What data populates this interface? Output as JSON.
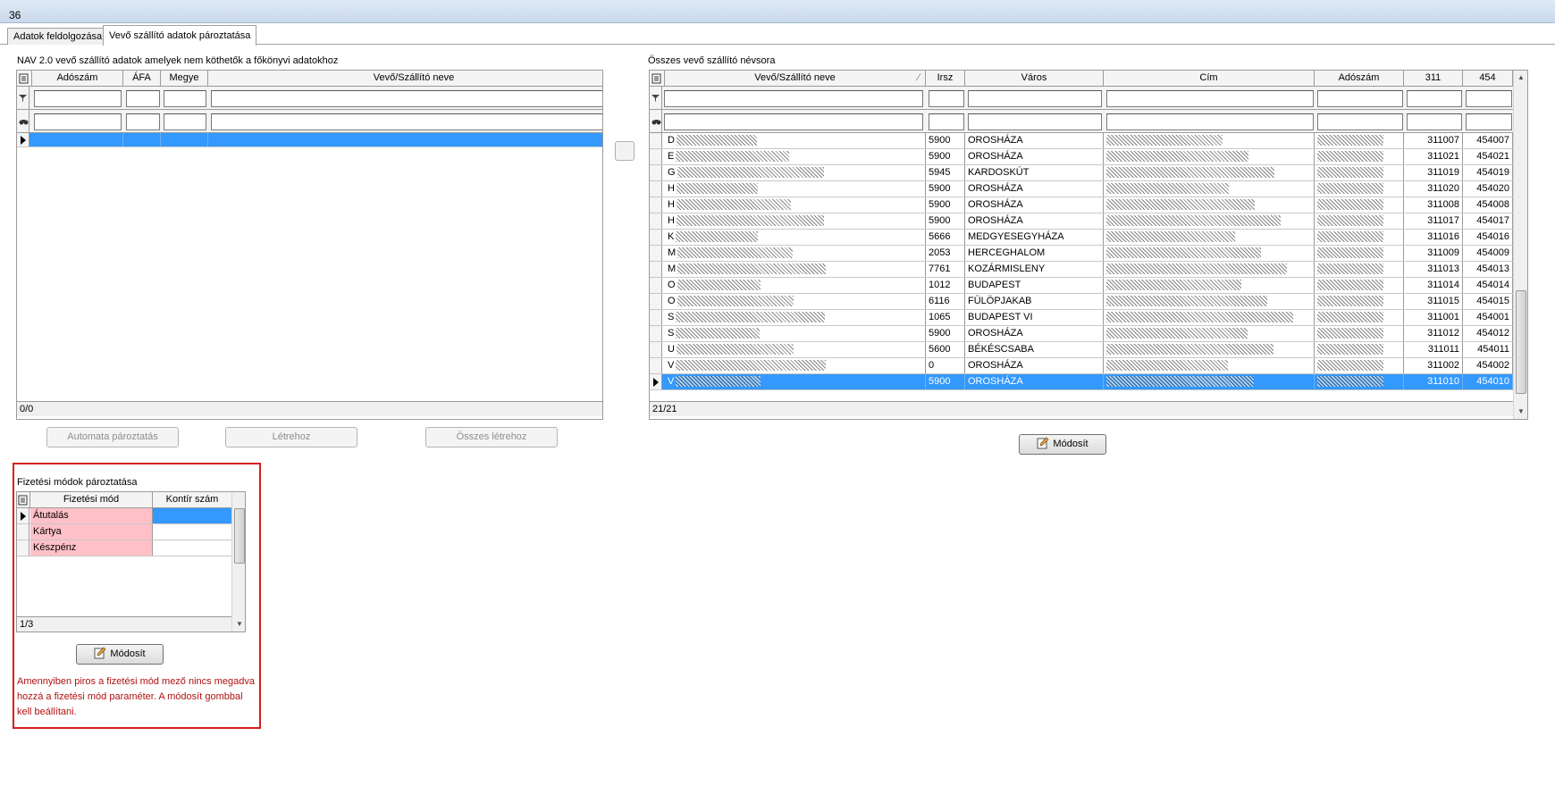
{
  "window": {
    "title": "36"
  },
  "tabs": [
    {
      "label": "Adatok feldolgozása"
    },
    {
      "label": "Vevő szállító adatok pároztatása"
    }
  ],
  "left_panel": {
    "caption": "NAV 2.0 vevő szállító adatok amelyek nem köthetők a főkönyvi adatokhoz",
    "columns": [
      "Adószám",
      "ÁFA",
      "Megye",
      "Vevő/Szállító neve"
    ],
    "status": "0/0",
    "buttons": {
      "auto": "Automata pároztatás",
      "create": "Létrehoz",
      "create_all": "Összes létrehoz"
    }
  },
  "right_panel": {
    "caption": "Összes vevő szállító névsora",
    "columns": [
      "Vevő/Szállító neve",
      "Irsz",
      "Város",
      "Cím",
      "Adószám",
      "311",
      "454"
    ],
    "rows": [
      {
        "initial": "D",
        "irsz": "5900",
        "varos": "OROSHÁZA",
        "c311": "311007",
        "c454": "454007"
      },
      {
        "initial": "E",
        "irsz": "5900",
        "varos": "OROSHÁZA",
        "c311": "311021",
        "c454": "454021"
      },
      {
        "initial": "G",
        "irsz": "5945",
        "varos": "KARDOSKÚT",
        "c311": "311019",
        "c454": "454019"
      },
      {
        "initial": "H",
        "irsz": "5900",
        "varos": "OROSHÁZA",
        "c311": "311020",
        "c454": "454020"
      },
      {
        "initial": "H",
        "irsz": "5900",
        "varos": "OROSHÁZA",
        "c311": "311008",
        "c454": "454008"
      },
      {
        "initial": "H",
        "irsz": "5900",
        "varos": "OROSHÁZA",
        "c311": "311017",
        "c454": "454017"
      },
      {
        "initial": "K",
        "irsz": "5666",
        "varos": "MEDGYESEGYHÁZA",
        "c311": "311016",
        "c454": "454016"
      },
      {
        "initial": "M",
        "irsz": "2053",
        "varos": "HERCEGHALOM",
        "c311": "311009",
        "c454": "454009"
      },
      {
        "initial": "M",
        "irsz": "7761",
        "varos": "KOZÁRMISLENY",
        "c311": "311013",
        "c454": "454013"
      },
      {
        "initial": "O",
        "irsz": "1012",
        "varos": "BUDAPEST",
        "c311": "311014",
        "c454": "454014"
      },
      {
        "initial": "O",
        "irsz": "6116",
        "varos": "FÜLÖPJAKAB",
        "c311": "311015",
        "c454": "454015"
      },
      {
        "initial": "S",
        "irsz": "1065",
        "varos": "BUDAPEST VI",
        "c311": "311001",
        "c454": "454001"
      },
      {
        "initial": "S",
        "irsz": "5900",
        "varos": "OROSHÁZA",
        "c311": "311012",
        "c454": "454012"
      },
      {
        "initial": "U",
        "irsz": "5600",
        "varos": "BÉKÉSCSABA",
        "c311": "311011",
        "c454": "454011"
      },
      {
        "initial": "V",
        "irsz": "0",
        "varos": "OROSHÁZA",
        "c311": "311002",
        "c454": "454002"
      },
      {
        "initial": "V",
        "irsz": "5900",
        "varos": "OROSHÁZA",
        "c311": "311010",
        "c454": "454010"
      }
    ],
    "status": "21/21",
    "modify_button": "Módosít"
  },
  "payment_panel": {
    "caption": "Fizetési módok pároztatása",
    "columns": [
      "Fizetési mód",
      "Kontír szám"
    ],
    "rows": [
      "Átutalás",
      "Kártya",
      "Készpénz"
    ],
    "status": "1/3",
    "modify_button": "Módosít",
    "note_lines": [
      "Amennyiben piros a fizetési mód mező nincs megadva",
      "hozzá a fizetési mód paraméter. A módosít gombbal",
      "kell beállítani."
    ]
  },
  "colors": {
    "selection": "#3399ff",
    "warning_border": "#d62020",
    "missing_mode": "#ffc0c8"
  }
}
